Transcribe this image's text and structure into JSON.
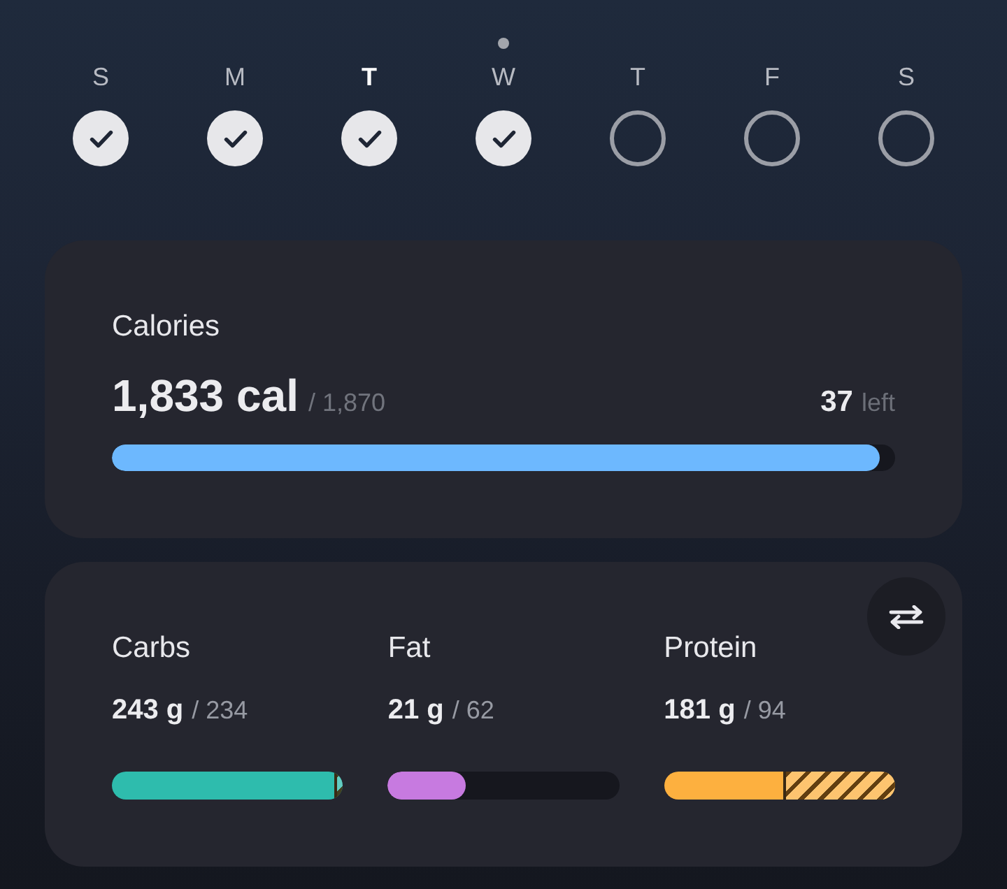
{
  "days": [
    {
      "letter": "S",
      "checked": true,
      "selected": false,
      "today": false
    },
    {
      "letter": "M",
      "checked": true,
      "selected": false,
      "today": false
    },
    {
      "letter": "T",
      "checked": true,
      "selected": true,
      "today": false
    },
    {
      "letter": "W",
      "checked": true,
      "selected": false,
      "today": true
    },
    {
      "letter": "T",
      "checked": false,
      "selected": false,
      "today": false
    },
    {
      "letter": "F",
      "checked": false,
      "selected": false,
      "today": false
    },
    {
      "letter": "S",
      "checked": false,
      "selected": false,
      "today": false
    }
  ],
  "calories": {
    "title": "Calories",
    "consumed": "1,833 cal",
    "goal": "/ 1,870",
    "remaining": "37",
    "remaining_label": "left",
    "level": 0.98
  },
  "macros": [
    {
      "name": "Carbs",
      "consumed": "243 g",
      "goal": "/ 234",
      "color": "#2ebcad",
      "level": 0.963,
      "over": true
    },
    {
      "name": "Fat",
      "consumed": "21 g",
      "goal": "/ 62",
      "color": "#c77ae0",
      "level": 0.339,
      "over": false
    },
    {
      "name": "Protein",
      "consumed": "181 g",
      "goal": "/ 94",
      "color": "#fdb03f",
      "level": 0.519,
      "over": true
    }
  ]
}
